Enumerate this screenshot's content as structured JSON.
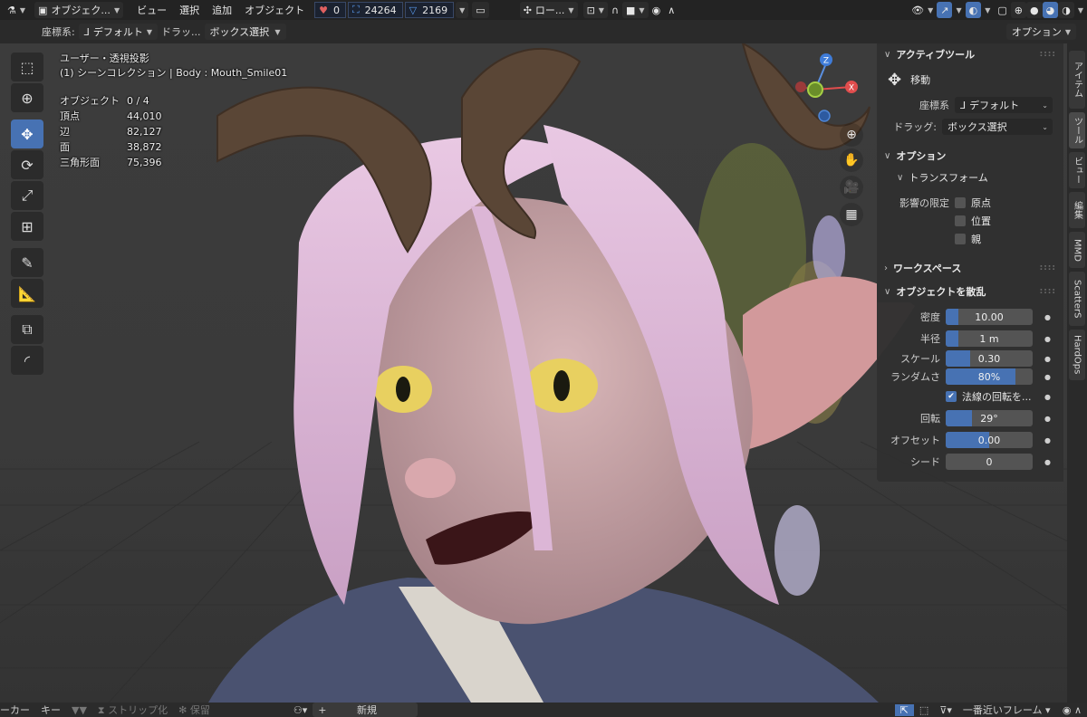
{
  "header": {
    "mode": "オブジェク...",
    "menus": [
      "ビュー",
      "選択",
      "追加",
      "オブジェクト"
    ],
    "stats": [
      {
        "icon": "heart-icon",
        "value": "0"
      },
      {
        "icon": "bounds-icon",
        "value": "24264"
      },
      {
        "icon": "vertex-icon",
        "value": "2169"
      }
    ],
    "pivot": "ロー..."
  },
  "toolbar2": {
    "coord_label": "座標系:",
    "coord_value": "デフォルト",
    "drag_label": "ドラッ...",
    "drag_value": "ボックス選択",
    "options": "オプション"
  },
  "viewport": {
    "view_name": "ユーザー・透視投影",
    "collection": "(1) シーンコレクション | Body : Mouth_Smile01",
    "stats": [
      {
        "key": "オブジェクト",
        "value": "0 / 4"
      },
      {
        "key": "頂点",
        "value": "44,010"
      },
      {
        "key": "辺",
        "value": "82,127"
      },
      {
        "key": "面",
        "value": "38,872"
      },
      {
        "key": "三角形面",
        "value": "75,396"
      }
    ],
    "gizmo": {
      "z": "Z",
      "x": "X"
    }
  },
  "npanel": {
    "active_tool": {
      "title": "アクティブツール",
      "tool_name": "移動",
      "coord_label": "座標系",
      "coord_value": "デフォルト",
      "drag_label": "ドラッグ:",
      "drag_value": "ボックス選択"
    },
    "options": {
      "title": "オプション",
      "transform_title": "トランスフォーム",
      "affect_label": "影響の限定",
      "checkboxes": [
        "原点",
        "位置",
        "親"
      ]
    },
    "workspace": {
      "title": "ワークスペース"
    },
    "scatter": {
      "title": "オブジェクトを散乱",
      "fields": [
        {
          "label": "密度",
          "value": "10.00",
          "fill": 0.15
        },
        {
          "label": "半径",
          "value": "1 m",
          "fill": 0.15
        },
        {
          "label": "スケール",
          "value": "0.30",
          "fill": 0.28
        },
        {
          "label": "ランダムさ",
          "value": "80%",
          "fill": 0.8
        }
      ],
      "normal_rotation": "法線の回転を...",
      "fields2": [
        {
          "label": "回転",
          "value": "29°",
          "fill": 0.3
        },
        {
          "label": "オフセット",
          "value": "0.00",
          "fill": 0.5
        },
        {
          "label": "シード",
          "value": "0",
          "fill": 0
        }
      ]
    }
  },
  "tabs": [
    "アイテム",
    "ツール",
    "ビュー",
    "編集",
    "MMD",
    "ScatterS",
    "HardOps"
  ],
  "bottom": {
    "items": [
      "ーカー",
      "キー"
    ],
    "strip": "ストリップ化",
    "keep": "保留",
    "new": "新規",
    "frame": "一番近いフレーム"
  },
  "colors": {
    "accent": "#4772b3",
    "header": "#232323",
    "panel": "#303030"
  }
}
